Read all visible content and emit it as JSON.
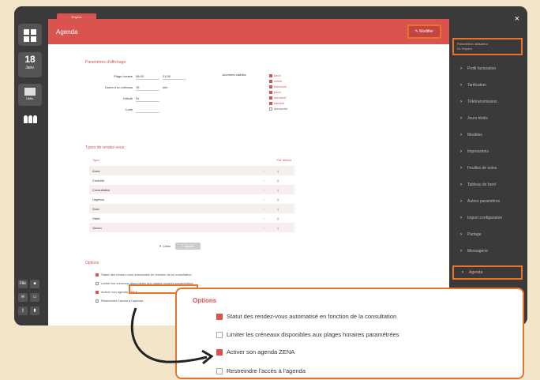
{
  "panel": {
    "tab_label": "Enyera",
    "title": "Agenda",
    "edit_button": "Modifier"
  },
  "rail": {
    "date_day": "18",
    "date_month": "Janv.",
    "user_label": "Utilis.",
    "mini_labels": [
      "File",
      "Rdv"
    ]
  },
  "display_params": {
    "title": "Paramètres d'affichage",
    "rows": [
      {
        "label": "Plage horaire",
        "v1": "08:00",
        "v2": "21:00"
      },
      {
        "label": "Durée d'un créneau",
        "v1": "15",
        "unit": "min"
      },
      {
        "label": "Intitulé",
        "v1": "Dr."
      },
      {
        "label": "Code",
        "v1": ""
      }
    ],
    "days_label": "Journées visibles",
    "days": [
      {
        "name": "lundi",
        "on": true
      },
      {
        "name": "mardi",
        "on": true
      },
      {
        "name": "mercredi",
        "on": true
      },
      {
        "name": "jeudi",
        "on": true
      },
      {
        "name": "vendredi",
        "on": true
      },
      {
        "name": "samedi",
        "on": true
      },
      {
        "name": "dimanche",
        "on": false
      }
    ]
  },
  "appointment_types": {
    "title": "Types de rendez-vous",
    "col_type": "Type",
    "col_default": "Par défaut",
    "rows": [
      "Autre",
      "Contrôle",
      "Consultation",
      "Urgence",
      "Suivi",
      "Visite",
      "Vaccin"
    ],
    "add_select": "Créer",
    "add_button": "Ajouter"
  },
  "options_small": {
    "title": "Options"
  },
  "sidebar": {
    "header_line1": "Paramètres utilisateur",
    "header_line2": "Dr. Enyera",
    "items": [
      "Profil facturation",
      "Tarification",
      "Télétransmission",
      "Jours fériés",
      "Modèles",
      "Impressions",
      "Feuilles de soins",
      "Tableau de bord",
      "Autres paramètres",
      "Import configuration",
      "Partage",
      "Messagerie",
      "Agenda"
    ],
    "close_glyph": "×"
  },
  "callout": {
    "title": "Options",
    "options": [
      {
        "label": "Statut des rendez-vous automatisé en fonction de la consultation",
        "on": true
      },
      {
        "label": "Limiter les créneaux disponibles aux plages horaires paramétrées",
        "on": false
      },
      {
        "label": "Activer son agenda ZENA",
        "on": true
      },
      {
        "label": "Restreindre l'accès à l'agenda",
        "on": false
      }
    ]
  },
  "colors": {
    "accent": "#d9534f",
    "highlight": "#e8732a",
    "background": "#f3e6c8"
  }
}
